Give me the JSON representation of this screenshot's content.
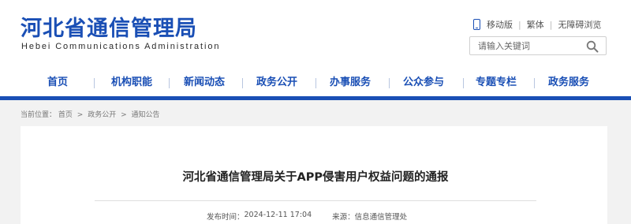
{
  "header": {
    "title": "河北省通信管理局",
    "subtitle": "Hebei Communications Administration",
    "links": [
      "移动版",
      "繁体",
      "无障碍浏览"
    ],
    "search": {
      "placeholder": "请输入关键词"
    }
  },
  "nav": {
    "items": [
      "首页",
      "机构职能",
      "新闻动态",
      "政务公开",
      "办事服务",
      "公众参与",
      "专题专栏",
      "政务服务"
    ]
  },
  "breadcrumb": {
    "prefix": "当前位置：",
    "items": [
      "首页",
      "政务公开",
      "通知公告"
    ],
    "separator": ">"
  },
  "article": {
    "title": "河北省通信管理局关于APP侵害用户权益问题的通报",
    "publish_label": "发布时间：",
    "publish_time": "2024-12-11 17:04",
    "source_label": "来源：",
    "source": "信息通信管理处"
  },
  "colors": {
    "brand_blue": "#1a4fb5",
    "page_background": "#f2f2f2"
  }
}
